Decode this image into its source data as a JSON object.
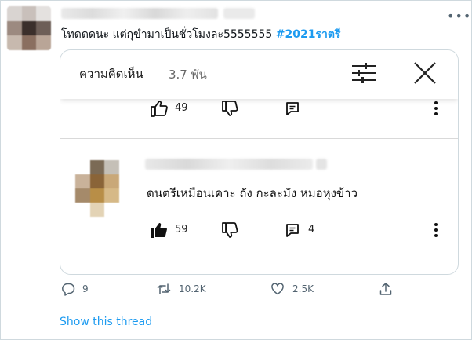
{
  "tweet": {
    "text": "โทดดดนะ แต่กุขำมาเป็นชั่วโมงละ5555555 ",
    "hashtag": "#2021ราตรี",
    "more_icon": "more-horizontal-icon"
  },
  "card": {
    "header": {
      "title": "ความคิดเห็น",
      "count": "3.7 พัน",
      "filter_icon": "sliders-icon",
      "close_icon": "close-icon"
    },
    "top_comment_actions": {
      "likes": "49"
    },
    "comment": {
      "text": "ดนตรีเหมือนเคาะ ถัง กะละมัง หมอหุงข้าว",
      "likes": "59",
      "replies": "4"
    }
  },
  "tweet_actions": {
    "replies": "9",
    "retweets": "10.2K",
    "likes": "2.5K"
  },
  "show_thread": "Show this thread",
  "colors": {
    "accent": "#1d9bf0",
    "secondary_text": "#536471",
    "border": "#cfd9de"
  }
}
